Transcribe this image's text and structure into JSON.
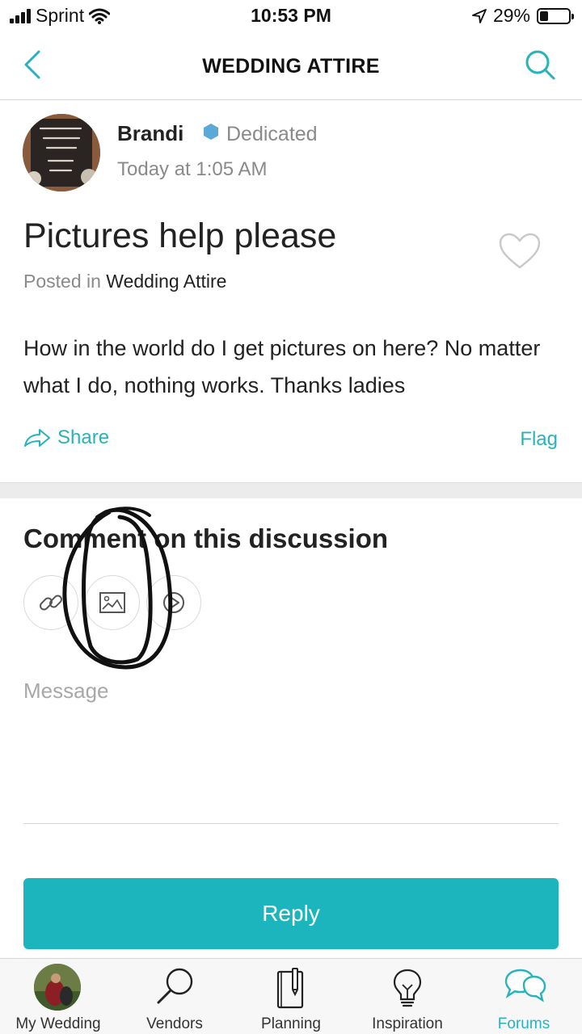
{
  "status_bar": {
    "carrier": "Sprint",
    "time": "10:53 PM",
    "battery_percent": "29%",
    "battery_level": 0.29
  },
  "nav": {
    "title": "WEDDING ATTIRE",
    "back_icon": "chevron-left-icon",
    "search_icon": "search-icon"
  },
  "post": {
    "author_name": "Brandi",
    "author_rank": "Dedicated",
    "timestamp": "Today at 1:05 AM",
    "title": "Pictures help please",
    "posted_in_label": "Posted in",
    "category": "Wedding Attire",
    "body": "How in the world do I get pictures on here? No matter what I do, nothing works. Thanks ladies",
    "share_label": "Share",
    "flag_label": "Flag"
  },
  "comment": {
    "heading": "Comment on this discussion",
    "message_placeholder": "Message",
    "reply_label": "Reply",
    "attach_icons": [
      "link-icon",
      "image-icon",
      "video-icon"
    ]
  },
  "tabs": [
    {
      "label": "My Wedding",
      "icon": "avatar",
      "active": false
    },
    {
      "label": "Vendors",
      "icon": "search-icon",
      "active": false
    },
    {
      "label": "Planning",
      "icon": "notebook-icon",
      "active": false
    },
    {
      "label": "Inspiration",
      "icon": "lightbulb-icon",
      "active": false
    },
    {
      "label": "Forums",
      "icon": "chat-bubbles-icon",
      "active": true
    }
  ],
  "colors": {
    "accent": "#27b3bb",
    "reply_button": "#1db5bd",
    "muted_text": "#8a8a8a",
    "badge": "#5aa9d6"
  }
}
